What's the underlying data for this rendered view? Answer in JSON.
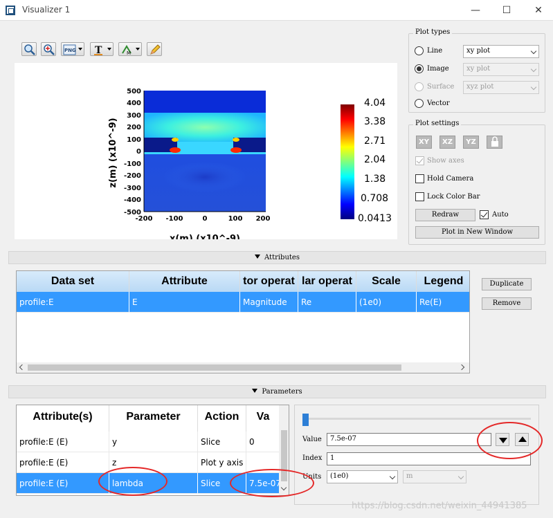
{
  "window": {
    "title": "Visualizer 1",
    "controls": [
      "—",
      "☐",
      "✕"
    ]
  },
  "colorbar": {
    "labels": [
      "4.04",
      "3.38",
      "2.71",
      "2.04",
      "1.38",
      "0.708",
      "0.0413"
    ]
  },
  "plot": {
    "y_axis_label": "z(m) (x10^-9)",
    "x_axis_label": "x(m) (x10^-9)",
    "y_ticks": [
      "500",
      "400",
      "300",
      "200",
      "100",
      "0",
      "-100",
      "-200",
      "-300",
      "-400",
      "-500"
    ],
    "x_ticks": [
      "-200",
      "-100",
      "0",
      "100",
      "200"
    ]
  },
  "plot_types": {
    "title": "Plot types",
    "options": [
      {
        "label": "Line",
        "combo": "xy plot",
        "selected": false,
        "enabled": true
      },
      {
        "label": "Image",
        "combo": "xy plot",
        "selected": true,
        "enabled": false
      },
      {
        "label": "Surface",
        "combo": "xyz plot",
        "selected": false,
        "enabled": false
      },
      {
        "label": "Vector",
        "combo": "",
        "selected": false,
        "enabled": true
      }
    ]
  },
  "plot_settings": {
    "title": "Plot settings",
    "axis_buttons": [
      "XY",
      "XZ",
      "YZ"
    ],
    "show_axes": "Show axes",
    "hold_camera": "Hold Camera",
    "lock_color_bar": "Lock Color Bar",
    "redraw": "Redraw",
    "auto": "Auto",
    "plot_new_window": "Plot in New Window"
  },
  "attributes": {
    "section_title": "Attributes",
    "columns": [
      "Data set",
      "Attribute",
      "tor operat",
      "lar operat",
      "Scale",
      "Legend"
    ],
    "rows": [
      [
        "profile:E",
        "E",
        "Magnitude",
        "Re",
        "(1e0)",
        "Re(E)"
      ]
    ],
    "duplicate": "Duplicate",
    "remove": "Remove"
  },
  "parameters": {
    "section_title": "Parameters",
    "columns": [
      "Attribute(s)",
      "Parameter",
      "Action",
      "Va"
    ],
    "rows": [
      [
        "profile:E (E)",
        "y",
        "Slice",
        "0"
      ],
      [
        "profile:E (E)",
        "z",
        "Plot y axis",
        ""
      ],
      [
        "profile:E (E)",
        "lambda",
        "Slice",
        "7.5e-07"
      ]
    ],
    "value_label": "Value",
    "value": "7.5e-07",
    "index_label": "Index",
    "index": "1",
    "units_label": "Units",
    "units_scale": "(1e0)",
    "units_unit": "m",
    "slider_fraction": 0
  },
  "watermark": "https://blog.csdn.net/weixin_44941385"
}
